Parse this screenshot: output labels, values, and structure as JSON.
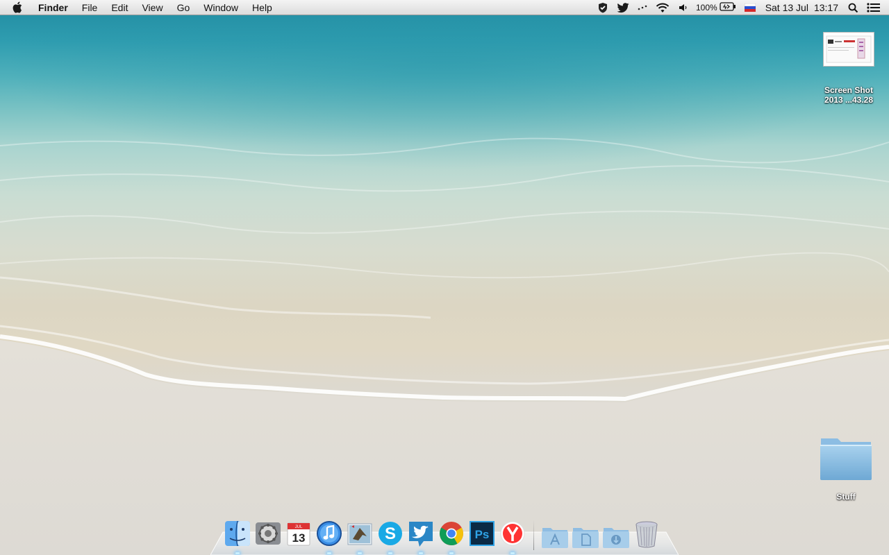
{
  "menubar": {
    "apple_icon": "apple-icon",
    "app_name": "Finder",
    "menus": [
      "File",
      "Edit",
      "View",
      "Go",
      "Window",
      "Help"
    ],
    "status": {
      "battery_percent": "100%",
      "input_source": "Russian",
      "date": "Sat 13 Jul",
      "time": "13:17"
    }
  },
  "desktop": {
    "screenshot_file": {
      "label_line1": "Screen Shot",
      "label_line2": "2013 ...43.28"
    },
    "folder": {
      "label": "Stuff"
    }
  },
  "dock": {
    "apps": [
      {
        "name": "Finder",
        "icon": "finder-icon",
        "running": true
      },
      {
        "name": "System Preferences",
        "icon": "system-preferences-icon",
        "running": false
      },
      {
        "name": "Calendar",
        "icon": "calendar-icon",
        "running": false,
        "month": "JUL",
        "day": "13"
      },
      {
        "name": "iTunes",
        "icon": "itunes-icon",
        "running": true
      },
      {
        "name": "Mail",
        "icon": "mail-icon",
        "running": true
      },
      {
        "name": "Skype",
        "icon": "skype-icon",
        "running": true
      },
      {
        "name": "Twitter",
        "icon": "twitter-icon",
        "running": true
      },
      {
        "name": "Google Chrome",
        "icon": "chrome-icon",
        "running": true
      },
      {
        "name": "Photoshop",
        "icon": "photoshop-icon",
        "running": false
      },
      {
        "name": "Yandex Browser",
        "icon": "yandex-icon",
        "running": true
      }
    ],
    "stacks": [
      {
        "name": "Applications",
        "icon": "applications-folder-icon"
      },
      {
        "name": "Documents",
        "icon": "documents-folder-icon"
      },
      {
        "name": "Downloads",
        "icon": "downloads-folder-icon"
      }
    ],
    "trash": {
      "name": "Trash",
      "icon": "trash-icon"
    }
  },
  "colors": {
    "sea": "#2f9db0",
    "sand": "#e0ddd5",
    "menubar": "#e8e8e8"
  }
}
